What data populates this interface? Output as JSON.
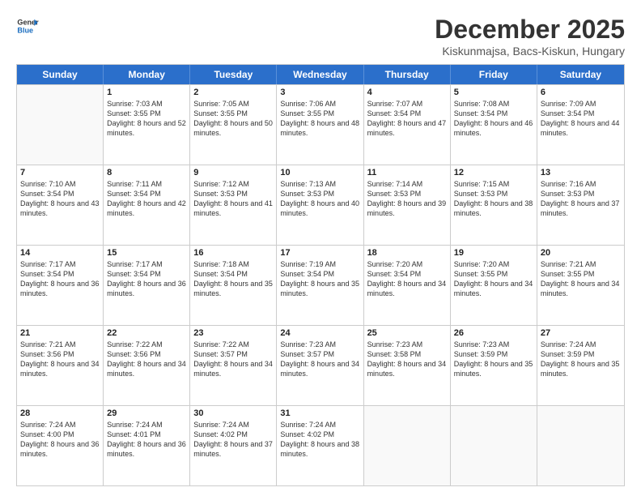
{
  "logo": {
    "line1": "General",
    "line2": "Blue"
  },
  "title": "December 2025",
  "subtitle": "Kiskunmajsa, Bacs-Kiskun, Hungary",
  "days_of_week": [
    "Sunday",
    "Monday",
    "Tuesday",
    "Wednesday",
    "Thursday",
    "Friday",
    "Saturday"
  ],
  "weeks": [
    [
      {
        "day": "",
        "empty": true
      },
      {
        "day": "1",
        "sunrise": "7:03 AM",
        "sunset": "3:55 PM",
        "daylight": "8 hours and 52 minutes."
      },
      {
        "day": "2",
        "sunrise": "7:05 AM",
        "sunset": "3:55 PM",
        "daylight": "8 hours and 50 minutes."
      },
      {
        "day": "3",
        "sunrise": "7:06 AM",
        "sunset": "3:55 PM",
        "daylight": "8 hours and 48 minutes."
      },
      {
        "day": "4",
        "sunrise": "7:07 AM",
        "sunset": "3:54 PM",
        "daylight": "8 hours and 47 minutes."
      },
      {
        "day": "5",
        "sunrise": "7:08 AM",
        "sunset": "3:54 PM",
        "daylight": "8 hours and 46 minutes."
      },
      {
        "day": "6",
        "sunrise": "7:09 AM",
        "sunset": "3:54 PM",
        "daylight": "8 hours and 44 minutes."
      }
    ],
    [
      {
        "day": "7",
        "sunrise": "7:10 AM",
        "sunset": "3:54 PM",
        "daylight": "8 hours and 43 minutes."
      },
      {
        "day": "8",
        "sunrise": "7:11 AM",
        "sunset": "3:54 PM",
        "daylight": "8 hours and 42 minutes."
      },
      {
        "day": "9",
        "sunrise": "7:12 AM",
        "sunset": "3:53 PM",
        "daylight": "8 hours and 41 minutes."
      },
      {
        "day": "10",
        "sunrise": "7:13 AM",
        "sunset": "3:53 PM",
        "daylight": "8 hours and 40 minutes."
      },
      {
        "day": "11",
        "sunrise": "7:14 AM",
        "sunset": "3:53 PM",
        "daylight": "8 hours and 39 minutes."
      },
      {
        "day": "12",
        "sunrise": "7:15 AM",
        "sunset": "3:53 PM",
        "daylight": "8 hours and 38 minutes."
      },
      {
        "day": "13",
        "sunrise": "7:16 AM",
        "sunset": "3:53 PM",
        "daylight": "8 hours and 37 minutes."
      }
    ],
    [
      {
        "day": "14",
        "sunrise": "7:17 AM",
        "sunset": "3:54 PM",
        "daylight": "8 hours and 36 minutes."
      },
      {
        "day": "15",
        "sunrise": "7:17 AM",
        "sunset": "3:54 PM",
        "daylight": "8 hours and 36 minutes."
      },
      {
        "day": "16",
        "sunrise": "7:18 AM",
        "sunset": "3:54 PM",
        "daylight": "8 hours and 35 minutes."
      },
      {
        "day": "17",
        "sunrise": "7:19 AM",
        "sunset": "3:54 PM",
        "daylight": "8 hours and 35 minutes."
      },
      {
        "day": "18",
        "sunrise": "7:20 AM",
        "sunset": "3:54 PM",
        "daylight": "8 hours and 34 minutes."
      },
      {
        "day": "19",
        "sunrise": "7:20 AM",
        "sunset": "3:55 PM",
        "daylight": "8 hours and 34 minutes."
      },
      {
        "day": "20",
        "sunrise": "7:21 AM",
        "sunset": "3:55 PM",
        "daylight": "8 hours and 34 minutes."
      }
    ],
    [
      {
        "day": "21",
        "sunrise": "7:21 AM",
        "sunset": "3:56 PM",
        "daylight": "8 hours and 34 minutes."
      },
      {
        "day": "22",
        "sunrise": "7:22 AM",
        "sunset": "3:56 PM",
        "daylight": "8 hours and 34 minutes."
      },
      {
        "day": "23",
        "sunrise": "7:22 AM",
        "sunset": "3:57 PM",
        "daylight": "8 hours and 34 minutes."
      },
      {
        "day": "24",
        "sunrise": "7:23 AM",
        "sunset": "3:57 PM",
        "daylight": "8 hours and 34 minutes."
      },
      {
        "day": "25",
        "sunrise": "7:23 AM",
        "sunset": "3:58 PM",
        "daylight": "8 hours and 34 minutes."
      },
      {
        "day": "26",
        "sunrise": "7:23 AM",
        "sunset": "3:59 PM",
        "daylight": "8 hours and 35 minutes."
      },
      {
        "day": "27",
        "sunrise": "7:24 AM",
        "sunset": "3:59 PM",
        "daylight": "8 hours and 35 minutes."
      }
    ],
    [
      {
        "day": "28",
        "sunrise": "7:24 AM",
        "sunset": "4:00 PM",
        "daylight": "8 hours and 36 minutes."
      },
      {
        "day": "29",
        "sunrise": "7:24 AM",
        "sunset": "4:01 PM",
        "daylight": "8 hours and 36 minutes."
      },
      {
        "day": "30",
        "sunrise": "7:24 AM",
        "sunset": "4:02 PM",
        "daylight": "8 hours and 37 minutes."
      },
      {
        "day": "31",
        "sunrise": "7:24 AM",
        "sunset": "4:02 PM",
        "daylight": "8 hours and 38 minutes."
      },
      {
        "day": "",
        "empty": true
      },
      {
        "day": "",
        "empty": true
      },
      {
        "day": "",
        "empty": true
      }
    ]
  ]
}
